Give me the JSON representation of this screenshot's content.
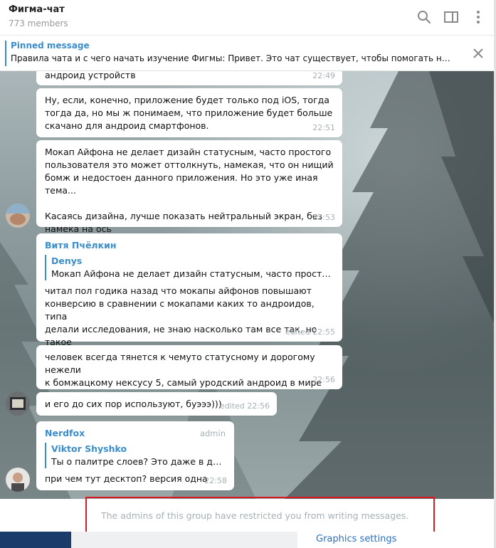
{
  "header": {
    "title": "Фигма-чат",
    "members": "773 members",
    "icons": [
      "search-icon",
      "sidebar-toggle-icon",
      "more-vertical-icon"
    ]
  },
  "pinned": {
    "title": "Pinned message",
    "text": "Правила чата и с чего начать изучение Фигмы:  Привет. Это чат существует, чтобы помогать нач..."
  },
  "messages": [
    {
      "text": "андроид устройств",
      "time": "22:49"
    },
    {
      "text": "Ну, если, конечно, приложение будет только под iOS, тогда\nтогда да, но мы ж понимаем, что приложение будет больше\nскачано для андроид смартфонов.",
      "time": "22:51"
    },
    {
      "text": "Мокап Айфона не делает дизайн статусным, часто простого\nпользователя это может оттолкнуть, намекая, что он нищий\nбомж и недостоен данного приложения. Но это уже иная тема...\n\nКасаясь дизайна, лучше показать нейтральный экран, без\nнамека на ось",
      "time": "22:53"
    },
    {
      "sender": "Витя Пчёлкин",
      "reply_name": "Denys",
      "reply_text": "Мокап Айфона не делает дизайн статусным, часто простого п...",
      "text": "читал пол годика назад что мокапы айфонов повышают\nконверсию в сравнении с мокапами каких то андроидов, типа\nделали исследования, не знаю насколько там все так, но такое\nчитал. поэтому хз",
      "time": "edited 22:55"
    },
    {
      "text": "человек всегда тянется к чемуто статусному и дорогому нежели\nк бомжацкому нексусу 5, самый уродский андроид в мире",
      "time": "22:56"
    },
    {
      "text": "и его до сих пор используют, буэээ)))",
      "time": "edited 22:56"
    },
    {
      "sender": "Nerdfox",
      "admin": "admin",
      "reply_name": "Viktor Shyshko",
      "reply_text": "Ты о палитре слоев? Это даже в дескт...",
      "text": "при чем тут десктоп? версия одна",
      "time": "22:58"
    }
  ],
  "footer": {
    "restricted": "The admins of this group have restricted you from writing messages.",
    "graphics_settings": "Graphics settings"
  },
  "colors": {
    "accent": "#3a8ecb",
    "highlight_border": "#d71a21",
    "meta_text": "#a7b1b5"
  }
}
